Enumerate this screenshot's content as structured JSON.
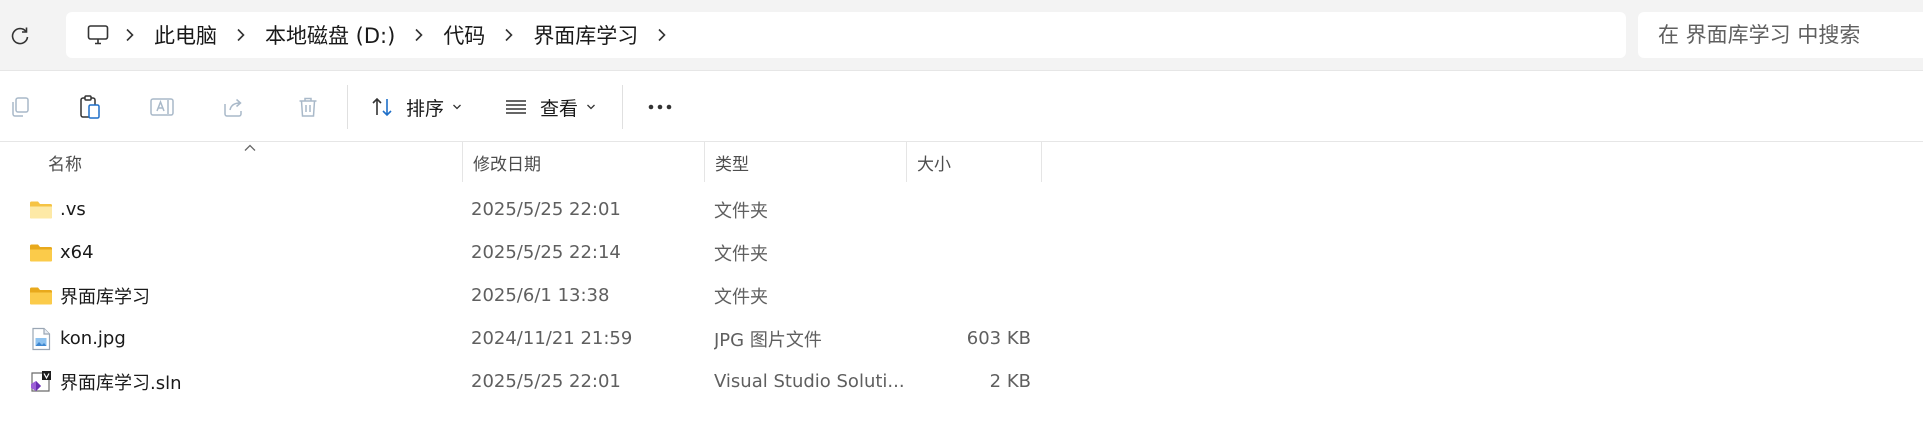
{
  "address": {
    "crumbs": [
      "此电脑",
      "本地磁盘 (D:)",
      "代码",
      "界面库学习"
    ]
  },
  "search": {
    "placeholder": "在 界面库学习 中搜索"
  },
  "toolbar": {
    "sort_label": "排序",
    "view_label": "查看"
  },
  "columns": {
    "name": "名称",
    "date": "修改日期",
    "type": "类型",
    "size": "大小"
  },
  "files": [
    {
      "name": ".vs",
      "date": "2025/5/25 22:01",
      "type": "文件夹",
      "size": "",
      "icon": "folder-icon"
    },
    {
      "name": "x64",
      "date": "2025/5/25 22:14",
      "type": "文件夹",
      "size": "",
      "icon": "folder-icon"
    },
    {
      "name": "界面库学习",
      "date": "2025/6/1 13:38",
      "type": "文件夹",
      "size": "",
      "icon": "folder-icon"
    },
    {
      "name": "kon.jpg",
      "date": "2024/11/21 21:59",
      "type": "JPG 图片文件",
      "size": "603 KB",
      "icon": "image-file-icon"
    },
    {
      "name": "界面库学习.sln",
      "date": "2025/5/25 22:01",
      "type": "Visual Studio Soluti...",
      "size": "2 KB",
      "icon": "visual-studio-solution-icon"
    }
  ],
  "colors": {
    "address_bg": "#f3f3f3",
    "folder": "#f5c344",
    "folder_light": "#fbdc7a",
    "disabled_icon": "#a9b9c9"
  }
}
